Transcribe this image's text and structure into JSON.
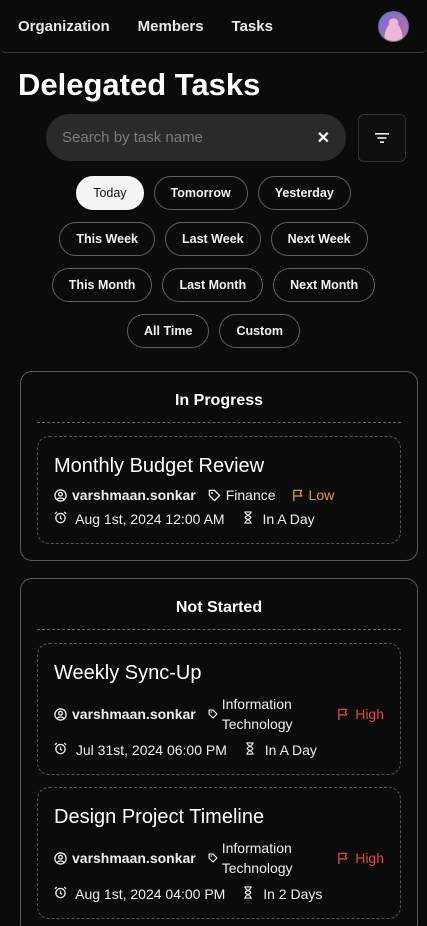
{
  "nav": {
    "links": [
      "Organization",
      "Members",
      "Tasks"
    ]
  },
  "page": {
    "title": "Delegated Tasks"
  },
  "search": {
    "placeholder": "Search by task name",
    "value": ""
  },
  "filters": {
    "active": "Today",
    "rows": [
      [
        "Today",
        "Tomorrow",
        "Yesterday"
      ],
      [
        "This Week",
        "Last Week",
        "Next Week"
      ],
      [
        "This Month",
        "Last Month",
        "Next Month"
      ],
      [
        "All Time",
        "Custom"
      ]
    ]
  },
  "sections": [
    {
      "title": "In Progress",
      "tasks": [
        {
          "title": "Monthly Budget Review",
          "assignee": "varshmaan.sonkar",
          "category": "Finance",
          "priority": "Low",
          "date": "Aug 1st, 2024 12:00 AM",
          "due": "In A Day"
        }
      ]
    },
    {
      "title": "Not Started",
      "tasks": [
        {
          "title": "Weekly Sync-Up",
          "assignee": "varshmaan.sonkar",
          "category_line1": "Information",
          "category_line2": "Technology",
          "priority": "High",
          "date": "Jul 31st, 2024 06:00 PM",
          "due": "In A Day"
        },
        {
          "title": "Design Project Timeline",
          "assignee": "varshmaan.sonkar",
          "category_line1": "Information",
          "category_line2": "Technology",
          "priority": "High",
          "date": "Aug 1st, 2024 04:00 PM",
          "due": "In 2 Days"
        }
      ]
    }
  ],
  "colors": {
    "background": "#0b0b0c",
    "priority_low": "#e5a024",
    "priority_high": "#e24848"
  }
}
